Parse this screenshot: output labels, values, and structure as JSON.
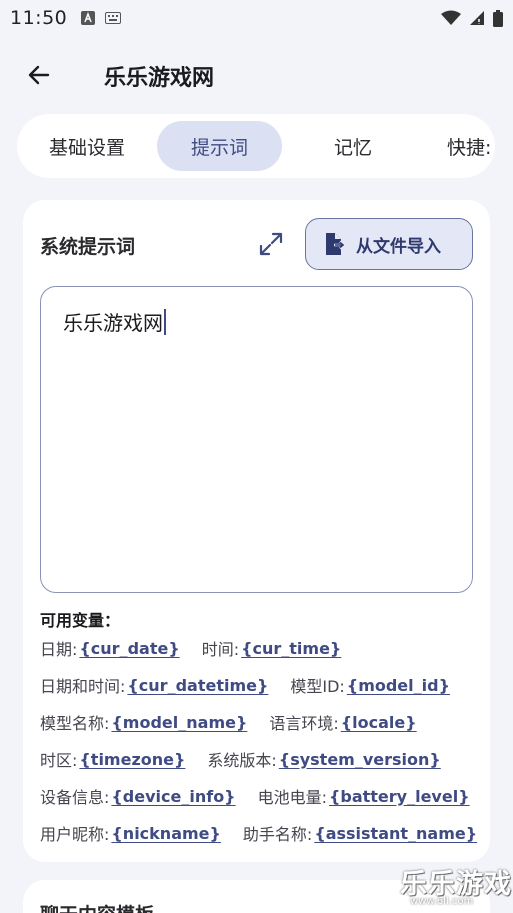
{
  "status_bar": {
    "time": "11:50"
  },
  "app_bar": {
    "title": "乐乐游戏网"
  },
  "tabs": [
    {
      "label": "基础设置",
      "active": false
    },
    {
      "label": "提示词",
      "active": true
    },
    {
      "label": "记忆",
      "active": false
    },
    {
      "label": "快捷:",
      "active": false
    }
  ],
  "system_prompt": {
    "title": "系统提示词",
    "import_label": "从文件导入",
    "value": "乐乐游戏网"
  },
  "variables": {
    "title": "可用变量：",
    "rows": [
      [
        {
          "label": "日期:",
          "token": "{cur_date}"
        },
        {
          "label": "时间:",
          "token": "{cur_time}"
        }
      ],
      [
        {
          "label": "日期和时间:",
          "token": "{cur_datetime}"
        },
        {
          "label": "模型ID:",
          "token": "{model_id}"
        }
      ],
      [
        {
          "label": "模型名称:",
          "token": "{model_name}"
        },
        {
          "label": "语言环境:",
          "token": "{locale}"
        }
      ],
      [
        {
          "label": "时区:",
          "token": "{timezone}"
        },
        {
          "label": "系统版本:",
          "token": "{system_version}"
        }
      ],
      [
        {
          "label": "设备信息:",
          "token": "{device_info}"
        },
        {
          "label": "电池电量:",
          "token": "{battery_level}"
        }
      ],
      [
        {
          "label": "用户昵称:",
          "token": "{nickname}"
        },
        {
          "label": "助手名称:",
          "token": "{assistant_name}"
        }
      ]
    ]
  },
  "next_card": {
    "title": "聊天内容模板"
  },
  "watermark": {
    "text": "乐乐游戏",
    "url": "www.6ll.com"
  },
  "colors": {
    "accent": "#3F4B82",
    "tab_active_bg": "#DBE1F3",
    "background": "#F3F4F9"
  }
}
